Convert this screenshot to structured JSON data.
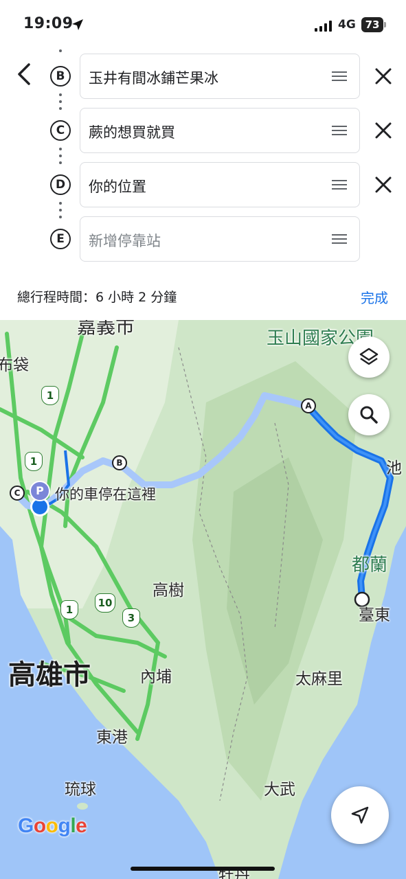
{
  "status_bar": {
    "time": "19:09",
    "network": "4G",
    "battery": "73"
  },
  "waypoints": [
    {
      "letter": "B",
      "text": "玉井有間冰鋪芒果冰",
      "removable": true
    },
    {
      "letter": "C",
      "text": "蕨的想買就買",
      "removable": true
    },
    {
      "letter": "D",
      "text": "你的位置",
      "removable": true
    },
    {
      "letter": "E",
      "placeholder": "新增停靠站",
      "removable": false
    }
  ],
  "summary": {
    "total_time": "總行程時間：6 小時 2 分鐘",
    "done_label": "完成"
  },
  "map": {
    "labels": {
      "chiayi": "嘉義市",
      "budai": "布袋",
      "yushan": "玉山國家公園",
      "chi": "池",
      "dulan": "都蘭",
      "taitung": "臺東",
      "gaoshu": "高樹",
      "kaohsiung": "高雄市",
      "neipu": "內埔",
      "taimali": "太麻里",
      "donggang": "東港",
      "liuqiu": "琉球",
      "dawu": "大武",
      "parking": "你的車停在這裡",
      "bottom": "牡丹"
    },
    "markers": {
      "a": "A",
      "b": "B",
      "c": "C"
    },
    "parking_badge": "P",
    "road_shields": [
      "1",
      "1",
      "1",
      "10",
      "3"
    ],
    "google_logo": "Google",
    "icons": [
      "layers-icon",
      "search-icon",
      "navigation-arrow-icon"
    ],
    "colors": {
      "route": "#1a73e8",
      "route_alt": "#a8c7fa",
      "highway": "#56c95c",
      "water": "#9fc5f8",
      "land": "#cfe6c8",
      "link": "#1a73e8"
    }
  }
}
